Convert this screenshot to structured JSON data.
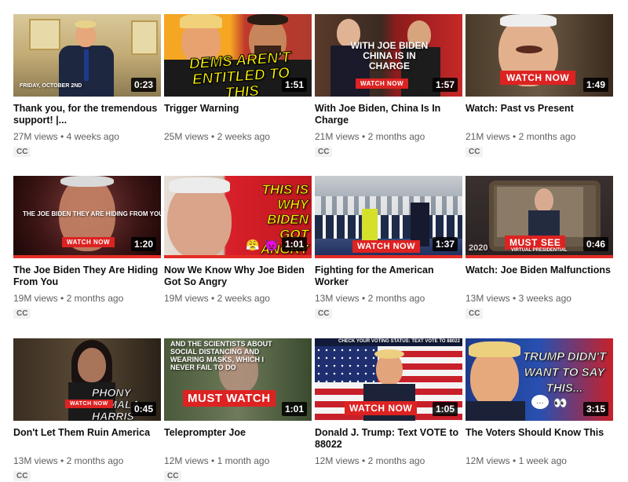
{
  "videos": [
    {
      "title": "Thank you, for the tremendous support! |...",
      "views": "27M views",
      "age": "4 weeks ago",
      "duration": "0:23",
      "cc": "CC",
      "overlay": "FRIDAY, OCTOBER 2ND"
    },
    {
      "title": "Trigger Warning",
      "views": "25M views",
      "age": "2 weeks ago",
      "duration": "1:51",
      "cc": "",
      "overlay": "DEMS AREN'T ENTITLED TO THIS"
    },
    {
      "title": "With Joe Biden, China Is In Charge",
      "views": "21M views",
      "age": "2 months ago",
      "duration": "1:57",
      "cc": "CC",
      "overlay": "WITH JOE BIDEN CHINA IS IN CHARGE",
      "badge": "WATCH NOW"
    },
    {
      "title": "Watch: Past vs Present",
      "views": "21M views",
      "age": "2 months ago",
      "duration": "1:49",
      "cc": "CC",
      "badge": "WATCH NOW"
    },
    {
      "title": "The Joe Biden They Are Hiding From You",
      "views": "19M views",
      "age": "2 months ago",
      "duration": "1:20",
      "cc": "CC",
      "overlay": "THE JOE BIDEN THEY ARE HIDING FROM YOU",
      "badge": "WATCH NOW"
    },
    {
      "title": "Now We Know Why Joe Biden Got So Angry",
      "views": "19M views",
      "age": "2 weeks ago",
      "duration": "1:01",
      "cc": "",
      "overlay": "THIS IS WHY BIDEN GOT ANGRY"
    },
    {
      "title": "Fighting for the American Worker",
      "views": "13M views",
      "age": "2 months ago",
      "duration": "1:37",
      "cc": "CC",
      "badge": "WATCH NOW"
    },
    {
      "title": "Watch: Joe Biden Malfunctions",
      "views": "13M views",
      "age": "3 weeks ago",
      "duration": "0:46",
      "cc": "CC",
      "overlay": "2020",
      "badge": "MUST SEE",
      "sub": "VIRTUAL PRESIDENTIAL"
    },
    {
      "title": "Don't Let Them Ruin America",
      "views": "13M views",
      "age": "2 months ago",
      "duration": "0:45",
      "cc": "CC",
      "overlay": "PHONY KAMALA HARRIS",
      "badge": "WATCH NOW"
    },
    {
      "title": "Teleprompter Joe",
      "views": "12M views",
      "age": "1 month ago",
      "duration": "1:01",
      "cc": "CC",
      "overlay": "AND THE SCIENTISTS ABOUT SOCIAL DISTANCING AND WEARING MASKS, WHICH I NEVER FAIL TO DO",
      "badge": "MUST WATCH"
    },
    {
      "title": "Donald J. Trump: Text VOTE to 88022",
      "views": "12M views",
      "age": "2 months ago",
      "duration": "1:05",
      "cc": "",
      "overlay": "CHECK YOUR VOTING STATUS: TEXT VOTE TO 88022",
      "badge": "WATCH NOW"
    },
    {
      "title": "The Voters Should Know This",
      "views": "12M views",
      "age": "1 week ago",
      "duration": "3:15",
      "cc": "",
      "overlay": "TRUMP DIDN'T WANT TO SAY THIS..."
    }
  ],
  "colors": {
    "progress": "#e52d27",
    "meta": "#606060"
  }
}
